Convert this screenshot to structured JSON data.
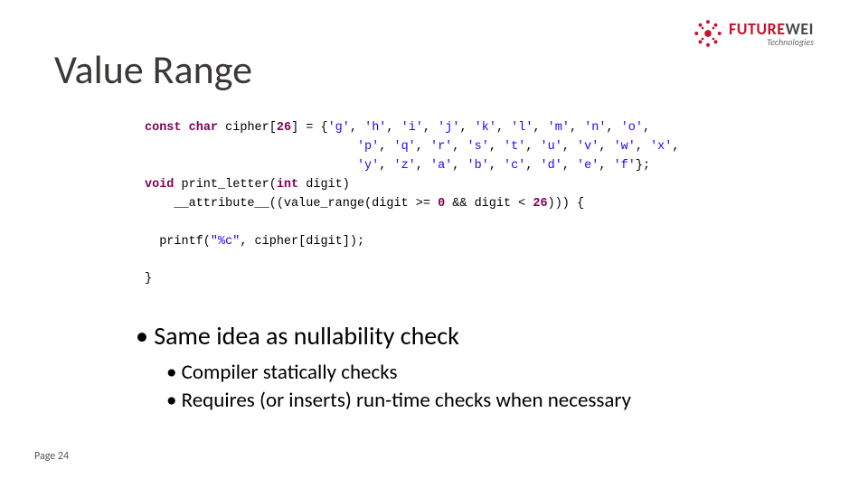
{
  "title": "Value Range",
  "logo": {
    "name_part1": "FUTURE",
    "name_part2": "WEI",
    "sub": "Technologies"
  },
  "code": {
    "l1a": "const",
    "l1b": "char",
    "l1c": "cipher[",
    "l1d": "26",
    "l1e": "] = {",
    "l1f": "'g'",
    "l1g": ", ",
    "l1h": "'h'",
    "l1i": ", ",
    "l1j": "'i'",
    "l1k": ", ",
    "l1l": "'j'",
    "l1m": ", ",
    "l1n": "'k'",
    "l1o": ", ",
    "l1p": "'l'",
    "l1q": ", ",
    "l1r": "'m'",
    "l1s": ", ",
    "l1t": "'n'",
    "l1u": ", ",
    "l1v": "'o'",
    "l1w": ",",
    "l2pad": "                             ",
    "l2a": "'p'",
    "l2b": ", ",
    "l2c": "'q'",
    "l2d": ", ",
    "l2e": "'r'",
    "l2f": ", ",
    "l2g": "'s'",
    "l2h": ", ",
    "l2i": "'t'",
    "l2j": ", ",
    "l2k": "'u'",
    "l2l": ", ",
    "l2m": "'v'",
    "l2n": ", ",
    "l2o": "'w'",
    "l2p": ", ",
    "l2q": "'x'",
    "l2r": ",",
    "l3pad": "                             ",
    "l3a": "'y'",
    "l3b": ", ",
    "l3c": "'z'",
    "l3d": ", ",
    "l3e": "'a'",
    "l3f": ", ",
    "l3g": "'b'",
    "l3h": ", ",
    "l3i": "'c'",
    "l3j": ", ",
    "l3k": "'d'",
    "l3l": ", ",
    "l3m": "'e'",
    "l3n": ", ",
    "l3o": "'f'",
    "l3p": "};",
    "l4a": "void",
    "l4b": " print_letter(",
    "l4c": "int",
    "l4d": " digit)",
    "l5pad": "    ",
    "l5a": "__attribute__((value_range(digit >= ",
    "l5b": "0",
    "l5c": " && digit < ",
    "l5d": "26",
    "l5e": "))) {",
    "l6pad": "  ",
    "l6a": "printf(",
    "l6b": "\"%c\"",
    "l6c": ", cipher[digit]);",
    "l7": "}"
  },
  "bullets": {
    "b1": "Same idea as nullability check",
    "b2a": "Compiler statically checks",
    "b2b": "Requires (or inserts) run-time checks when necessary"
  },
  "page": "Page 24"
}
